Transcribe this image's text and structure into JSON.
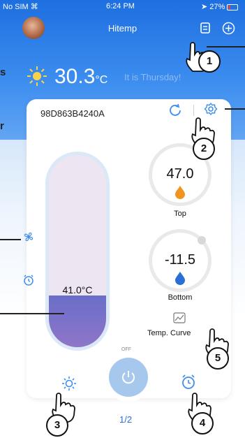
{
  "status_bar": {
    "carrier": "No SIM",
    "time": "6:24 PM",
    "battery": "27%"
  },
  "header": {
    "title": "Hitemp"
  },
  "weather": {
    "temperature": "30.3",
    "unit": "°C",
    "message": "It is Thursday!"
  },
  "device": {
    "id": "98D863B4240A"
  },
  "tank": {
    "temperature": "41.0°C",
    "fill_fraction": 0.27
  },
  "gauges": [
    {
      "value": "47.0",
      "label": "Top",
      "color": "#f0941f"
    },
    {
      "value": "-11.5",
      "label": "Bottom",
      "color": "#2a6fd6"
    }
  ],
  "curve": {
    "label": "Temp. Curve"
  },
  "power": {
    "state_label": "OFF"
  },
  "pagination": {
    "text": "1/2"
  },
  "annotations": {
    "n1": "1",
    "n2": "2",
    "n3": "3",
    "n4": "4",
    "n5": "5"
  },
  "margin_text": {
    "left_top": "s",
    "left_mid": "r"
  },
  "colors": {
    "accent": "#3d8ef0",
    "header_top": "#1e6fe0"
  }
}
